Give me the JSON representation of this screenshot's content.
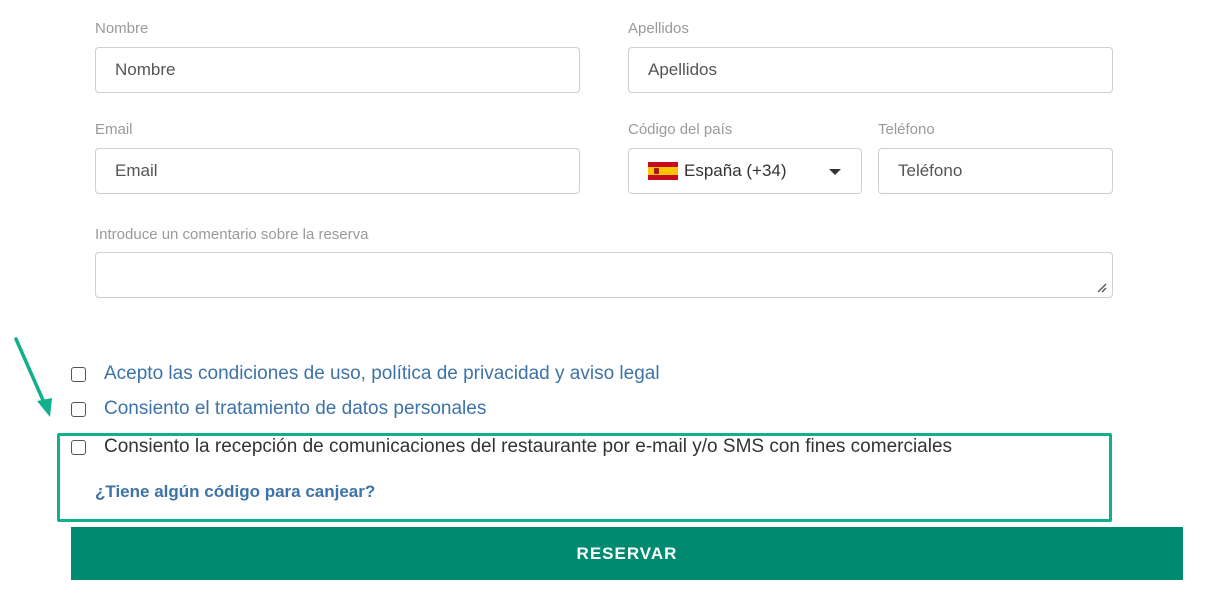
{
  "form": {
    "nombre": {
      "label": "Nombre",
      "placeholder": "Nombre"
    },
    "apellidos": {
      "label": "Apellidos",
      "placeholder": "Apellidos"
    },
    "email": {
      "label": "Email",
      "placeholder": "Email"
    },
    "pais": {
      "label": "Código del país",
      "value": "España (+34)",
      "flag": "spain-flag-icon"
    },
    "telefono": {
      "label": "Teléfono",
      "placeholder": "Teléfono"
    },
    "comentario": {
      "label": "Introduce un comentario sobre la reserva"
    }
  },
  "consents": [
    {
      "text": "Acepto las condiciones de uso, política de privacidad y aviso legal",
      "checked": false
    },
    {
      "text": "Consiento el tratamiento de datos personales",
      "checked": false
    },
    {
      "text": "Consiento la recepción de comunicaciones del restaurante por e-mail y/o SMS con fines comerciales",
      "checked": false
    }
  ],
  "promo_link": "¿Tiene algún código para canjear?",
  "submit_label": "RESERVAR",
  "colors": {
    "accent": "#008a70",
    "highlight": "#10b08c",
    "link": "#3d73a8"
  }
}
